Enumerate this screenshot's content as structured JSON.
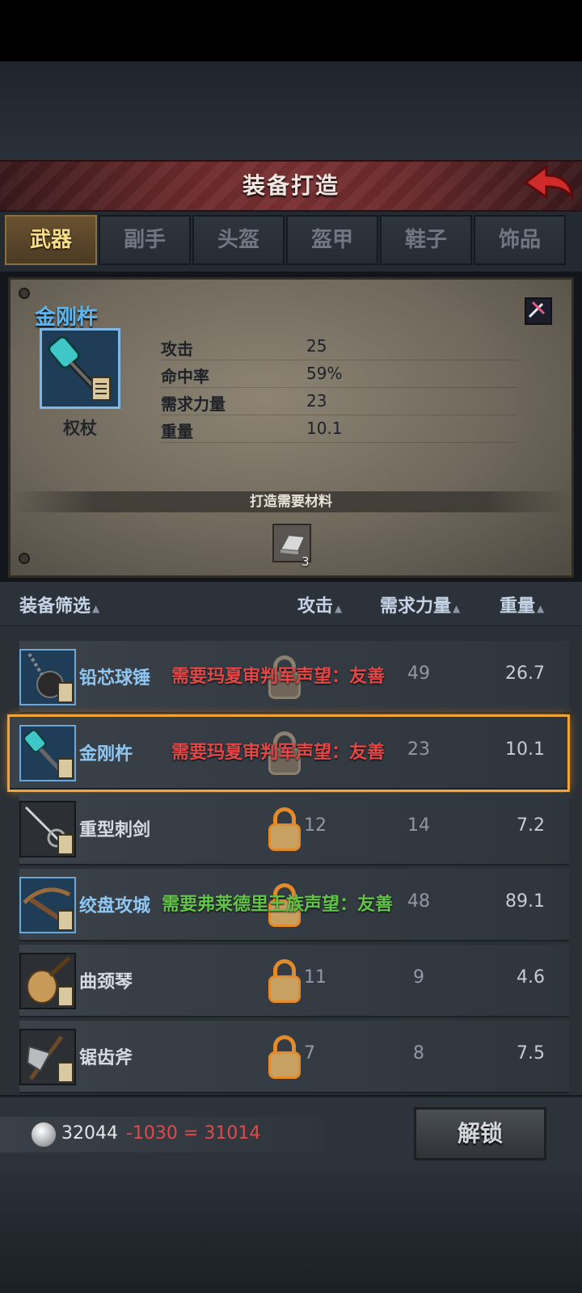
{
  "header": {
    "title": "装备打造",
    "back_icon": "back-arrow-icon"
  },
  "tabs": [
    {
      "label": "武器",
      "active": true
    },
    {
      "label": "副手",
      "active": false
    },
    {
      "label": "头盔",
      "active": false
    },
    {
      "label": "盔甲",
      "active": false
    },
    {
      "label": "鞋子",
      "active": false
    },
    {
      "label": "饰品",
      "active": false
    }
  ],
  "detail": {
    "name": "金刚杵",
    "type": "权杖",
    "icon": "vajra-mace-icon",
    "stats": [
      {
        "label": "攻击",
        "value": "25"
      },
      {
        "label": "命中率",
        "value": "59%"
      },
      {
        "label": "需求力量",
        "value": "23"
      },
      {
        "label": "重量",
        "value": "10.1"
      }
    ],
    "materials_title": "打造需要材料",
    "materials": [
      {
        "icon": "silver-ingot-icon",
        "count": "3"
      }
    ]
  },
  "list_header": {
    "filter": "装备筛选",
    "attack": "攻击",
    "strength": "需求力量",
    "weight": "重量"
  },
  "items": [
    {
      "name": "铅芯球锤",
      "requirement": "需要玛夏审判军声望：友善",
      "req_color": "red",
      "attack": "",
      "strength": "49",
      "weight": "26.7",
      "icon": "flail-icon",
      "rarity": "blue",
      "locked_style": "dim",
      "selected": false
    },
    {
      "name": "金刚杵",
      "requirement": "需要玛夏审判军声望：友善",
      "req_color": "red",
      "attack": "",
      "strength": "23",
      "weight": "10.1",
      "icon": "vajra-mace-icon",
      "rarity": "blue",
      "locked_style": "dim",
      "selected": true
    },
    {
      "name": "重型刺剑",
      "requirement": "",
      "req_color": "",
      "attack": "12",
      "strength": "14",
      "weight": "7.2",
      "icon": "rapier-icon",
      "rarity": "normal",
      "locked_style": "gold",
      "selected": false
    },
    {
      "name": "绞盘攻城",
      "requirement": "需要弗莱德里王族声望：友善",
      "req_color": "green",
      "attack": "",
      "strength": "48",
      "weight": "89.1",
      "icon": "crossbow-icon",
      "rarity": "blue",
      "locked_style": "gold",
      "selected": false
    },
    {
      "name": "曲颈琴",
      "requirement": "",
      "req_color": "",
      "attack": "11",
      "strength": "9",
      "weight": "4.6",
      "icon": "lute-icon",
      "rarity": "normal",
      "locked_style": "gold",
      "selected": false
    },
    {
      "name": "锯齿斧",
      "requirement": "",
      "req_color": "",
      "attack": "7",
      "strength": "8",
      "weight": "7.5",
      "icon": "serrated-axe-icon",
      "rarity": "normal",
      "locked_style": "gold",
      "selected": false
    }
  ],
  "footer": {
    "currency_icon": "silver-coin-icon",
    "balance": "32044",
    "calc": "-1030 = 31014",
    "unlock_label": "解锁"
  },
  "colors": {
    "accent_gold": "#f6dd86",
    "requirement_red": "#e24848",
    "requirement_green": "#62c44a",
    "rare_blue": "#5fb5ee",
    "selection_orange": "#f0a53a"
  }
}
